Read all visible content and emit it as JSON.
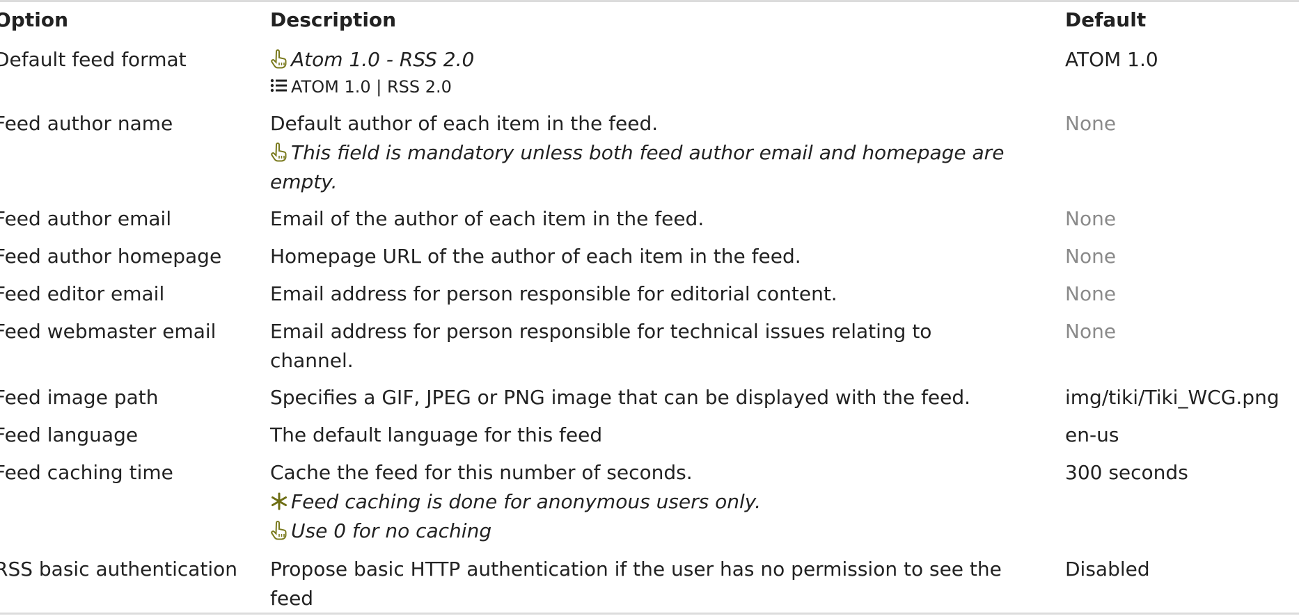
{
  "header": {
    "option": "Option",
    "description": "Description",
    "default": "Default"
  },
  "colors": {
    "hint_icon": "#7a7a1e",
    "muted_text": "#8a8a8a",
    "border": "#dcdcdc"
  },
  "rows": [
    {
      "option": "Default feed format",
      "hint": "Atom 1.0 - RSS 2.0",
      "hint_icon": "pointing-hand-icon",
      "options_list": "ATOM 1.0 | RSS 2.0",
      "options_icon": "list-icon",
      "default": "ATOM 1.0"
    },
    {
      "option": "Feed author name",
      "description": "Default author of each item in the feed.",
      "hint_line1": "This field is mandatory unless both feed author email and homepage are",
      "hint_line2": "empty.",
      "hint_icon": "pointing-hand-icon",
      "default": "None"
    },
    {
      "option": "Feed author email",
      "description": "Email of the author of each item in the feed.",
      "default": "None"
    },
    {
      "option": "Feed author homepage",
      "description": "Homepage URL of the author of each item in the feed.",
      "default": "None"
    },
    {
      "option": "Feed editor email",
      "description": "Email address for person responsible for editorial content.",
      "default": "None"
    },
    {
      "option": "Feed webmaster email",
      "description_line1": "Email address for person responsible for technical issues relating to",
      "description_line2": "channel.",
      "default": "None"
    },
    {
      "option": "Feed image path",
      "description": "Specifies a GIF, JPEG or PNG image that can be displayed with the feed.",
      "default": "img/tiki/Tiki_WCG.png"
    },
    {
      "option": "Feed language",
      "description": "The default language for this feed",
      "default": "en-us"
    },
    {
      "option": "Feed caching time",
      "description": "Cache the feed for this number of seconds.",
      "warning": "Feed caching is done for anonymous users only.",
      "warning_icon": "asterisk-icon",
      "hint": "Use 0 for no caching",
      "hint_icon": "pointing-hand-icon",
      "default": "300 seconds"
    },
    {
      "option": "RSS basic authentication",
      "description_line1": "Propose basic HTTP authentication if the user has no permission to see the",
      "description_line2": "feed",
      "default": "Disabled"
    }
  ]
}
